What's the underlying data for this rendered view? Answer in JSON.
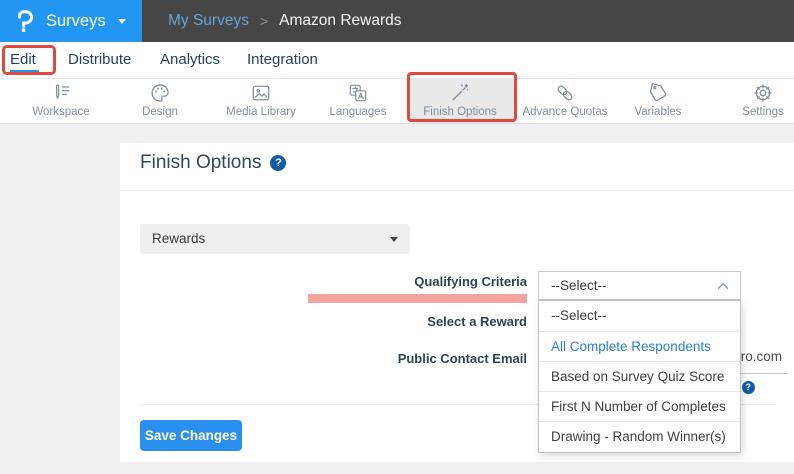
{
  "header": {
    "logo_glyph": "P",
    "product_menu": "Surveys",
    "breadcrumb": {
      "parent": "My Surveys",
      "separator": ">",
      "current": "Amazon Rewards"
    }
  },
  "nav": {
    "items": [
      {
        "label": "Edit",
        "active": true
      },
      {
        "label": "Distribute",
        "active": false
      },
      {
        "label": "Analytics",
        "active": false
      },
      {
        "label": "Integration",
        "active": false
      }
    ]
  },
  "toolbar": {
    "items": [
      {
        "label": "Workspace",
        "icon": "pencil-list-icon",
        "active": false
      },
      {
        "label": "Design",
        "icon": "palette-icon",
        "active": false
      },
      {
        "label": "Media Library",
        "icon": "image-icon",
        "active": false
      },
      {
        "label": "Languages",
        "icon": "translate-icon",
        "active": false
      },
      {
        "label": "Finish Options",
        "icon": "magic-wand-icon",
        "active": true
      },
      {
        "label": "Advance Quotas",
        "icon": "chain-link-icon",
        "active": false
      },
      {
        "label": "Variables",
        "icon": "tag-icon",
        "active": false
      },
      {
        "label": "Settings",
        "icon": "gear-icon",
        "active": false
      }
    ]
  },
  "main": {
    "title": "Finish Options",
    "rewards_selector": {
      "value": "Rewards"
    },
    "form": {
      "qualifying_criteria_label": "Qualifying Criteria",
      "select_reward_label": "Select a Reward",
      "public_contact_email_label": "Public Contact Email",
      "public_contact_email_value_visible": "ro.com",
      "email_helper_visible": "."
    },
    "save_button": "Save Changes"
  },
  "qualifying_dropdown": {
    "selected_value": "--Select--",
    "options": [
      {
        "label": "--Select--",
        "highlighted": false
      },
      {
        "label": "All Complete Respondents",
        "highlighted": true
      },
      {
        "label": "Based on Survey Quiz Score",
        "highlighted": false
      },
      {
        "label": "First N Number of Completes",
        "highlighted": false
      },
      {
        "label": "Drawing - Random Winner(s)",
        "highlighted": false
      }
    ]
  },
  "icons": {
    "help_glyph": "?"
  },
  "colors": {
    "brand_blue": "#2196f3",
    "topbar_dark": "#464646",
    "annotation_red": "#e2493e",
    "highlight_pink": "#f3a49e",
    "option_link_blue": "#2b7de0",
    "navy_text": "#2f4255",
    "save_button_blue": "#2a8fee"
  }
}
